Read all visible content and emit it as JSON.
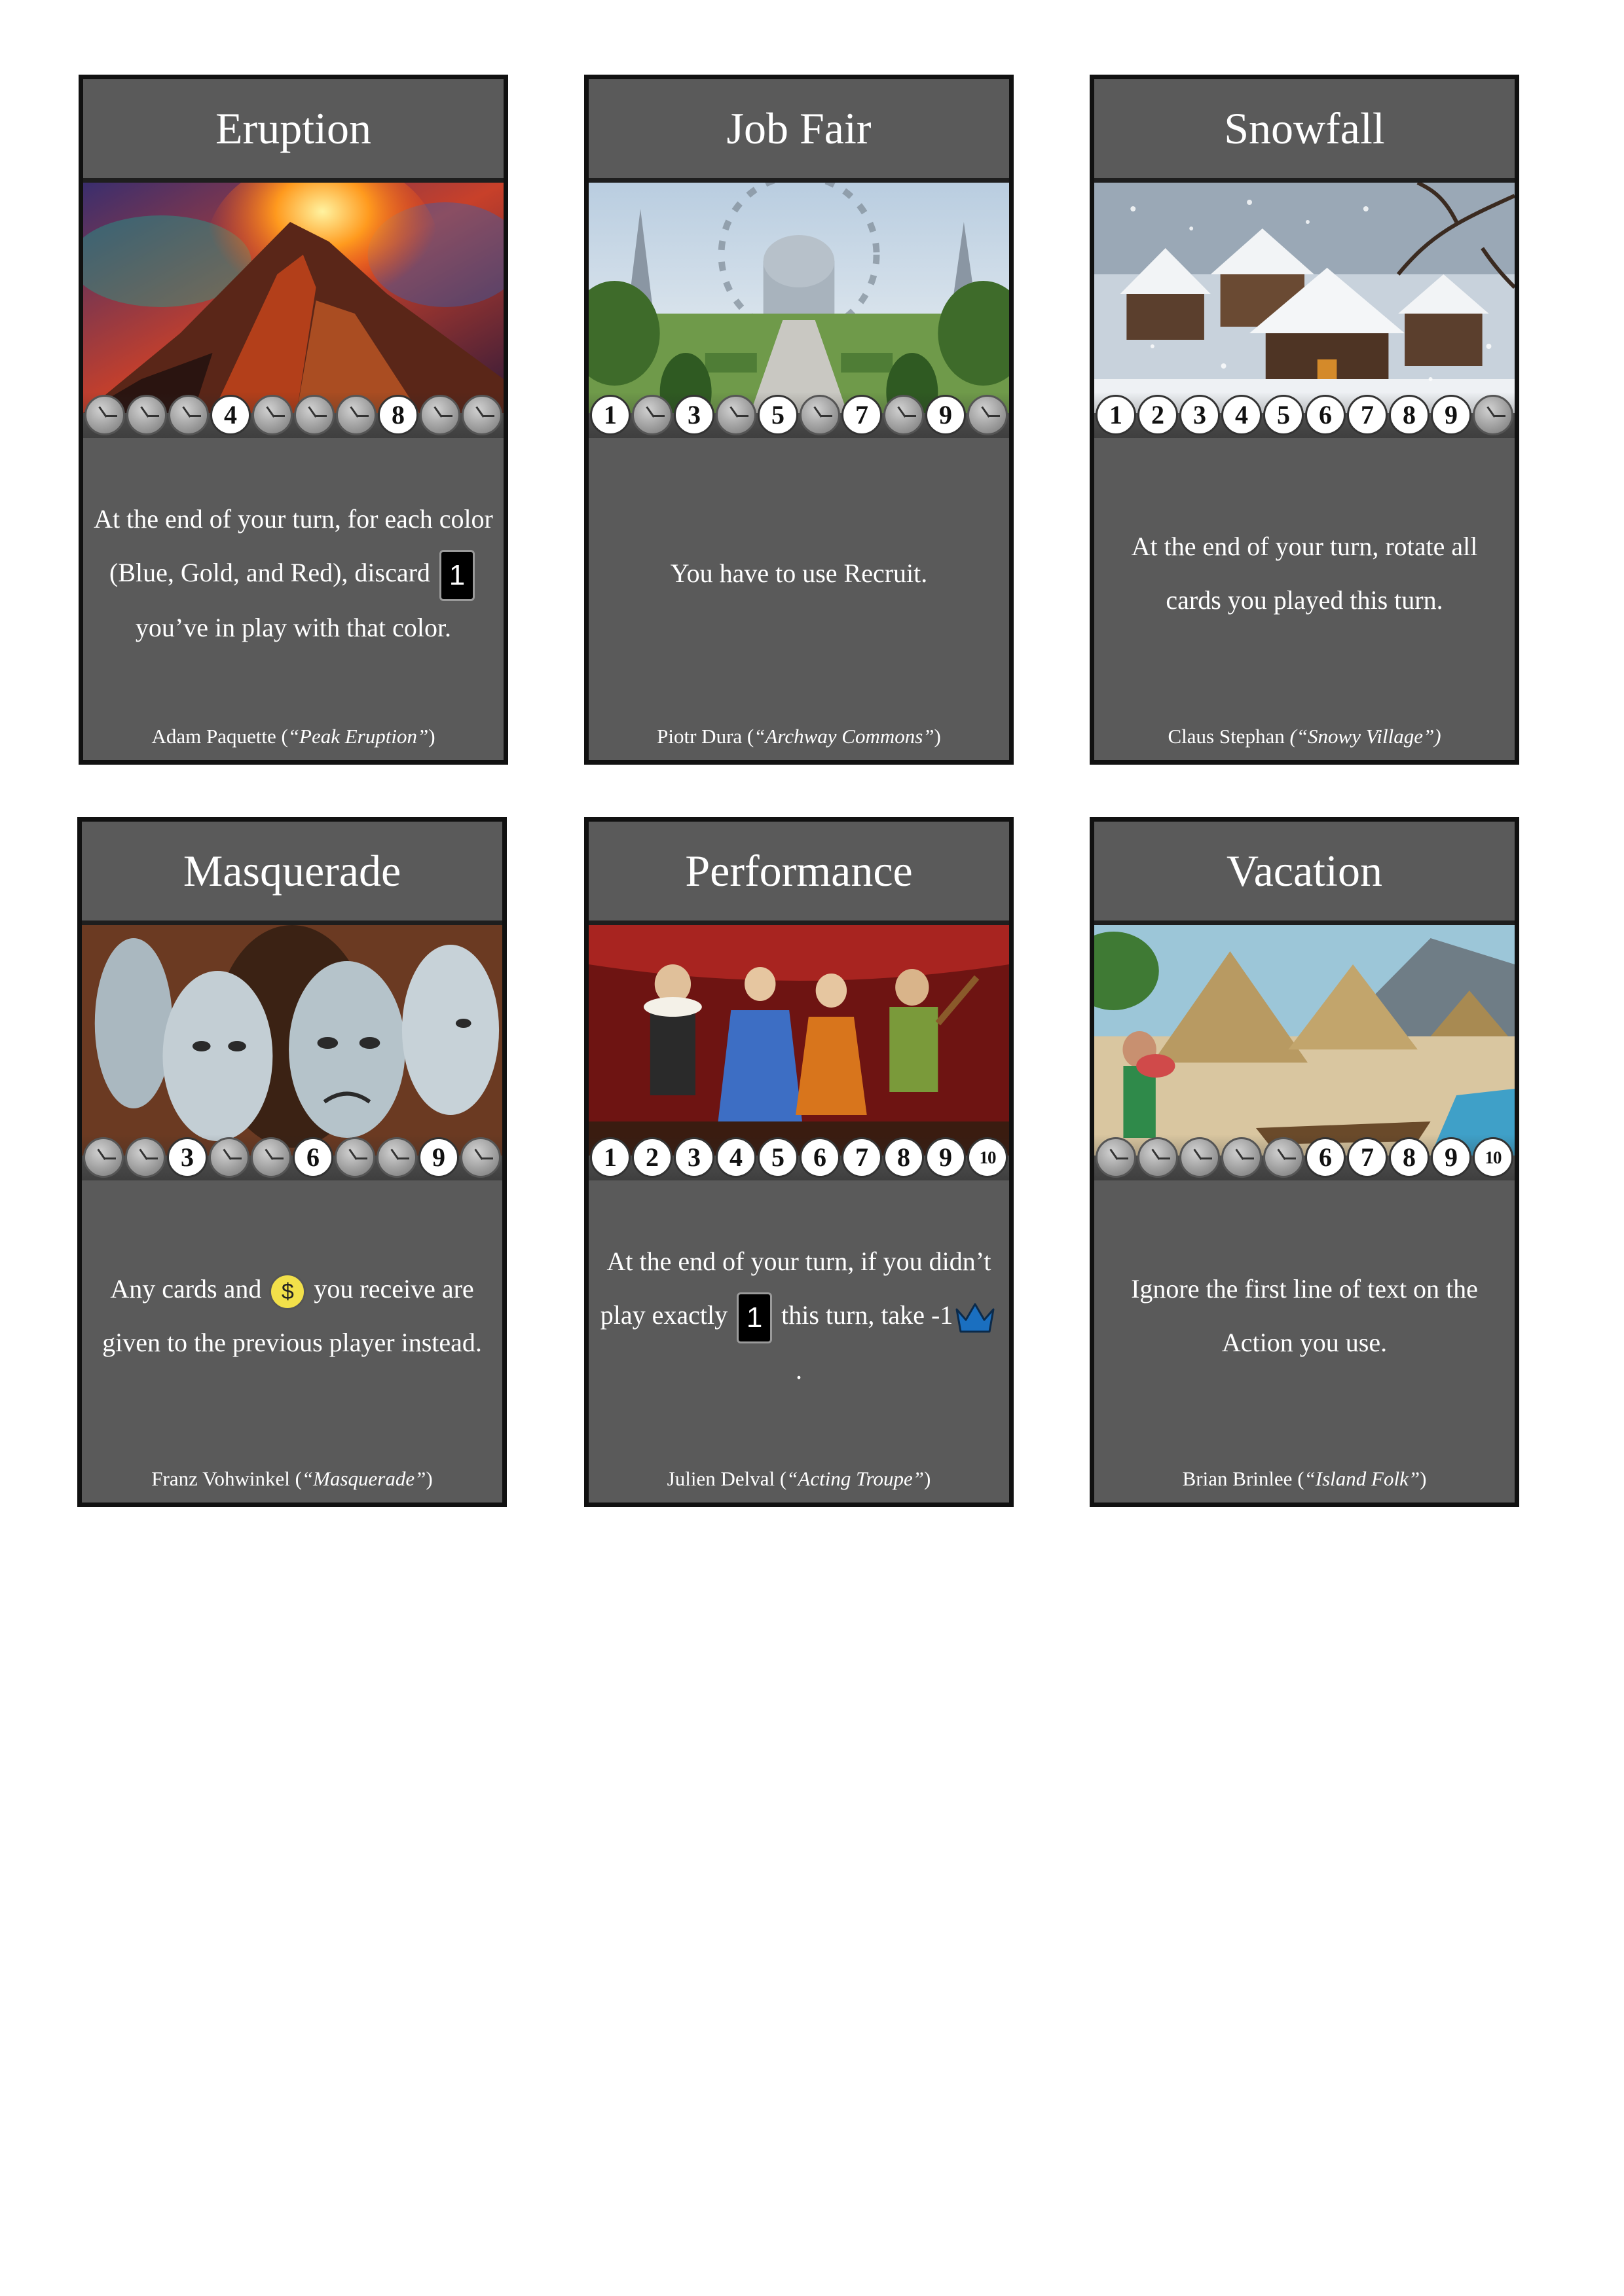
{
  "cards": [
    {
      "title": "Eruption",
      "art": "volcano",
      "clocks": [
        false,
        false,
        false,
        "4",
        false,
        false,
        false,
        "8",
        false,
        false
      ],
      "text_parts": [
        "At the end of your turn, for each color (Blue, Gold, and Red), discard ",
        "1",
        " you’ve in play with that color."
      ],
      "credit_name": "Adam Paquette (",
      "credit_title": "“Peak Eruption”",
      "credit_close": ")"
    },
    {
      "title": "Job Fair",
      "art": "city",
      "clocks": [
        "1",
        false,
        "3",
        false,
        "5",
        false,
        "7",
        false,
        "9",
        false
      ],
      "text_parts": [
        "You have to use Recruit."
      ],
      "credit_name": "Piotr Dura (",
      "credit_title": "“Archway Commons”",
      "credit_close": ")"
    },
    {
      "title": "Snowfall",
      "art": "snow",
      "clocks": [
        "1",
        "2",
        "3",
        "4",
        "5",
        "6",
        "7",
        "8",
        "9",
        false
      ],
      "text_parts": [
        "At the end of your turn, rotate all cards you played this turn."
      ],
      "credit_name": "Claus Stephan ",
      "credit_title": "(“Snowy Village”)",
      "credit_close": ""
    },
    {
      "title": "Masquerade",
      "art": "masks",
      "clocks": [
        false,
        false,
        "3",
        false,
        false,
        "6",
        false,
        false,
        "9",
        false
      ],
      "text_parts": [
        "Any cards and ",
        "$",
        " you receive are given to the previous player instead."
      ],
      "credit_name": "Franz Vohwinkel (",
      "credit_title": "“Masquerade”",
      "credit_close": ")"
    },
    {
      "title": "Performance",
      "art": "stage",
      "clocks": [
        "1",
        "2",
        "3",
        "4",
        "5",
        "6",
        "7",
        "8",
        "9",
        "10"
      ],
      "text_parts": [
        "At the end of your turn, if you didn’t play exactly ",
        "1",
        " this turn, take -1",
        "crown",
        "."
      ],
      "credit_name": "Julien Delval (",
      "credit_title": "“Acting Troupe”",
      "credit_close": ")"
    },
    {
      "title": "Vacation",
      "art": "island",
      "clocks": [
        false,
        false,
        false,
        false,
        false,
        "6",
        "7",
        "8",
        "9",
        "10"
      ],
      "text_parts": [
        "Ignore the first line of text on the Action you use."
      ],
      "credit_name": "Brian Brinlee (",
      "credit_title": "“Island Folk”",
      "credit_close": ")"
    }
  ],
  "colors": {
    "card_bg": "#5a5a5a",
    "border": "#111111",
    "coin": "#f2e04a",
    "crown": "#1a6fc0"
  }
}
